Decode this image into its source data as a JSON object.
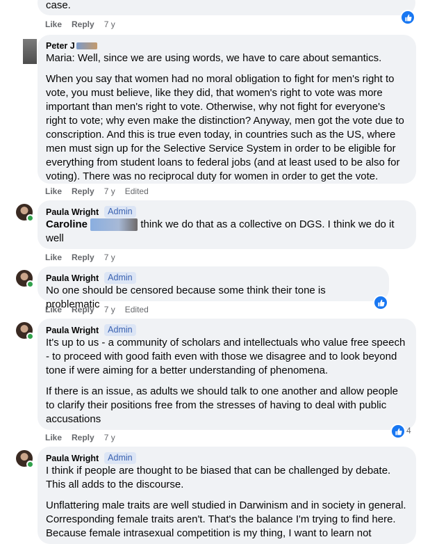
{
  "actions": {
    "like": "Like",
    "reply": "Reply",
    "edited": "Edited"
  },
  "comments": [
    {
      "text_fragment": "case.",
      "age": "7 y"
    },
    {
      "author": "Peter J",
      "paras": [
        "Maria: Well, since we are using words, we have to care about semantics.",
        "When you say that women had no moral obligation to fight for men's right to vote, you must believe, like they did, that women's right to vote was more important than men's right to vote. Otherwise, why not fight for everyone's right to vote; why even make the distinction? Anyway, men got the vote due to conscription. And this is true even today, in countries such as the US, where men must sign up for the Selective Service System in order to be eligible for everything from student loans to federal jobs (and at least used to be also for voting). There was no reciprocal duty for women in order to get the vote."
      ],
      "age": "7 y"
    },
    {
      "author": "Paula Wright",
      "badge": "Admin",
      "mention": "Caroline",
      "text": "think we do that as a collective on DGS. I think we do it well",
      "age": "7 y"
    },
    {
      "author": "Paula Wright",
      "badge": "Admin",
      "text": "No one should be censored because some think their tone is problematic",
      "age": "7 y"
    },
    {
      "author": "Paula Wright",
      "badge": "Admin",
      "paras": [
        "It's up to us - a community of scholars and intellectuals who value free speech - to proceed with good faith even with those we disagree and to look beyond tone if were aiming for a better understanding of phenomena.",
        "If there is an issue, as adults we should talk to one another and allow people to clarify their positions free from the stresses of having to deal with public accusations"
      ],
      "age": "7 y",
      "reaction_count": "4"
    },
    {
      "author": "Paula Wright",
      "badge": "Admin",
      "paras": [
        "I think if people are thought to be biased that can be challenged by debate. This all adds to the discourse.",
        "Unflattering male traits are well studied in Darwinism and in society in general. Corresponding female traits aren't. That's the balance I'm trying to find here.",
        "Because female intrasexual competition is my thing, I want to learn not"
      ]
    }
  ],
  "colors": {
    "bubble": "#f0f2f5",
    "like_blue": "#1877f2",
    "meta_grey": "#65676b",
    "admin_bg": "#dce5f5",
    "admin_text": "#3a62b0"
  },
  "icons": {
    "reaction": "thumbs-up-icon",
    "online": "online-dot-icon"
  }
}
